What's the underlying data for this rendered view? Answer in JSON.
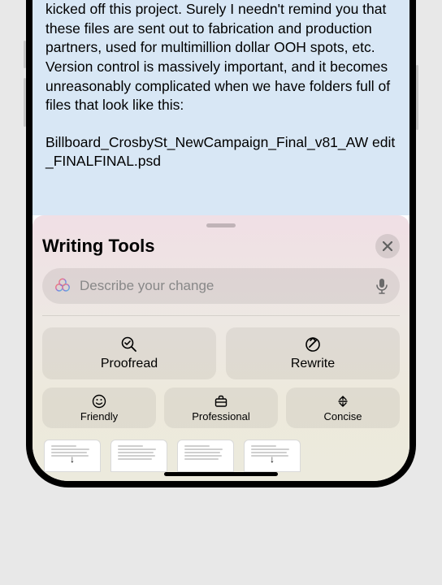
{
  "email": {
    "body": "kicked off this project. Surely I needn't remind you that these files are sent out to fabrication and production partners, used for multimillion dollar OOH spots, etc. Version control is massively important, and it becomes unreasonably complicated when we have folders full of files that look like this:",
    "filename": "Billboard_CrosbySt_NewCampaign_Final_v81_AW edit_FINALFINAL.psd"
  },
  "sheet": {
    "title": "Writing Tools",
    "input_placeholder": "Describe your change",
    "tools": {
      "proofread": "Proofread",
      "rewrite": "Rewrite",
      "friendly": "Friendly",
      "professional": "Professional",
      "concise": "Concise"
    }
  }
}
